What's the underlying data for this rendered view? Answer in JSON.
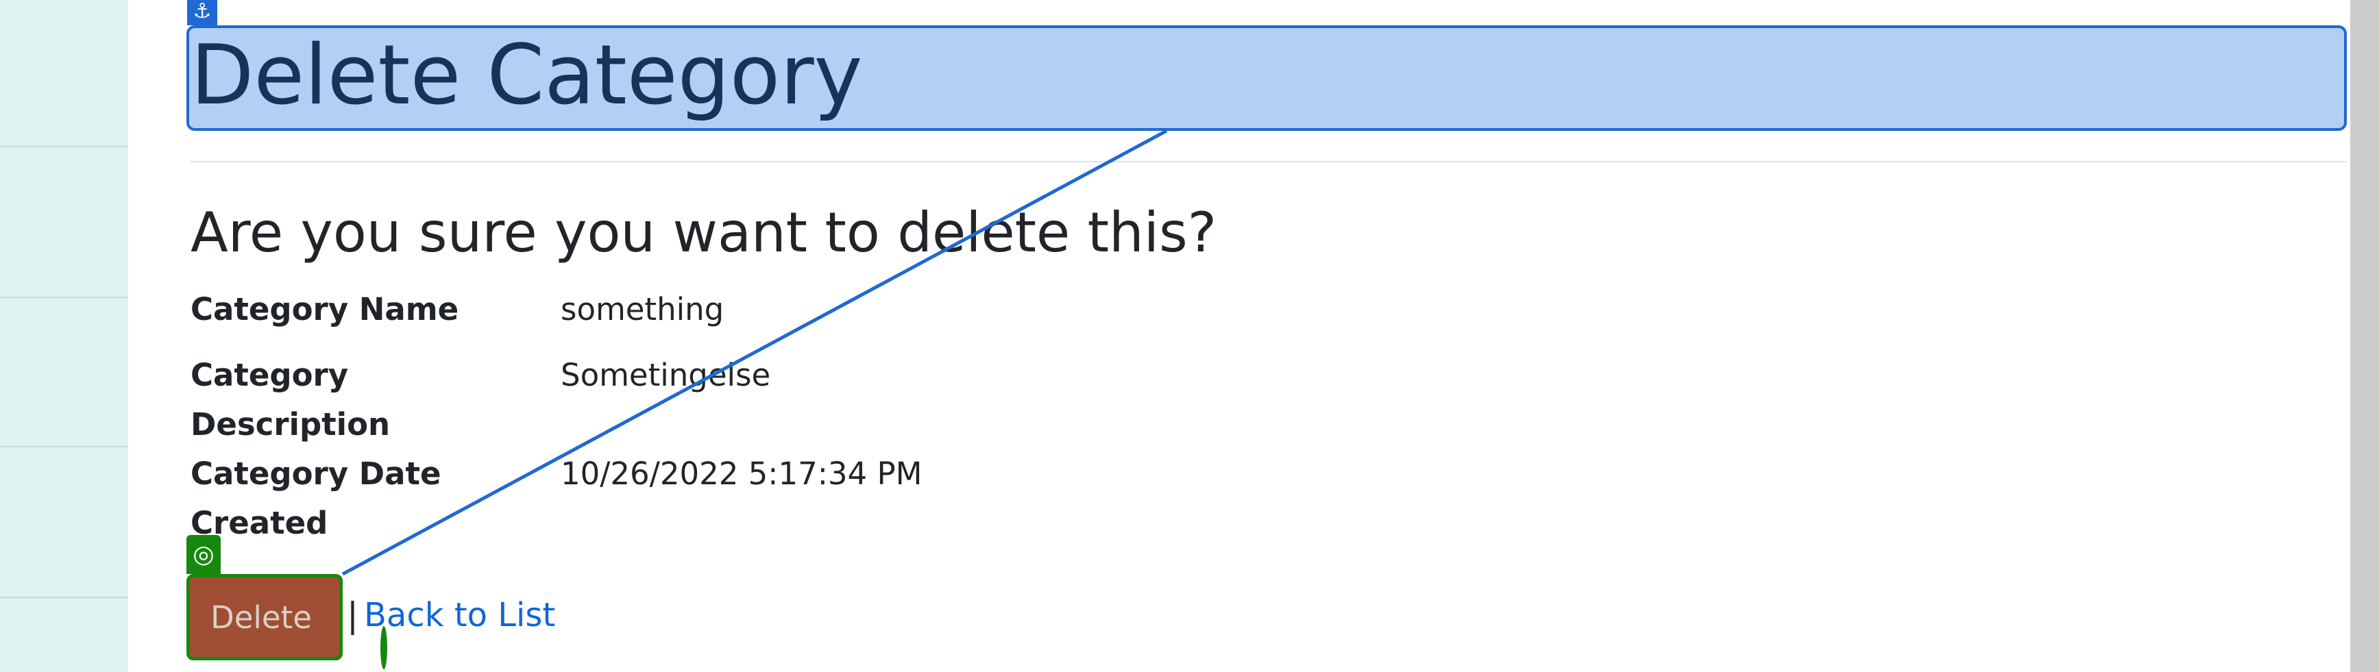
{
  "page": {
    "title": "Delete Category",
    "question": "Are you sure you want to delete this?"
  },
  "details": [
    {
      "label": "Category Name",
      "value": "something"
    },
    {
      "label": "Category Description",
      "value": "Sometingelse"
    },
    {
      "label": "Category Date Created",
      "value": "10/26/2022 5:17:34 PM"
    }
  ],
  "actions": {
    "delete_label": "Delete",
    "separator": "|",
    "back_label": "Back to List"
  },
  "overlay": {
    "anchor_glyph": "⚓",
    "target_glyph": "◎",
    "anchor_icon": "anchor-icon",
    "target_icon": "target-icon",
    "accent_blue": "#1f69d3",
    "accent_green": "#17880f"
  }
}
